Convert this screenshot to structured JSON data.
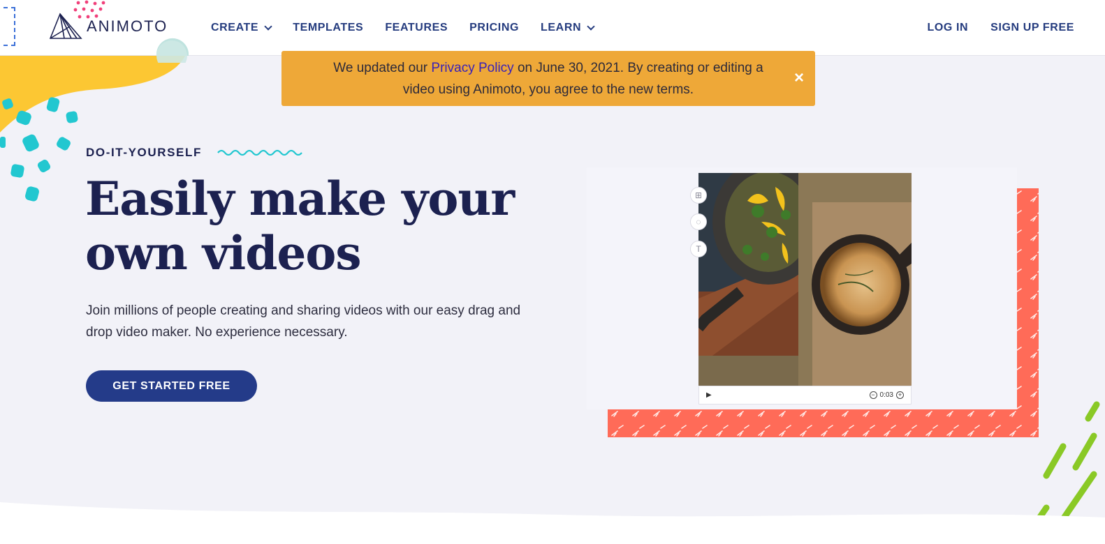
{
  "brand": {
    "name": "ANIMOTO",
    "colors": {
      "navy": "#1c2150",
      "nav_blue": "#243b7e",
      "cta_blue": "#243b89",
      "banner": "#eea838",
      "coral": "#ff6b58",
      "teal": "#22c7d0",
      "yellow": "#fcc733",
      "pink": "#f0407a",
      "green": "#8ac926"
    }
  },
  "nav": {
    "create": "CREATE",
    "templates": "TEMPLATES",
    "features": "FEATURES",
    "pricing": "PRICING",
    "learn": "LEARN",
    "login": "LOG IN",
    "signup": "SIGN UP FREE"
  },
  "banner": {
    "before_link": "We updated our ",
    "link": "Privacy Policy",
    "after_link": " on June 30, 2021. By creating or editing a video using Animoto, you agree to the new terms.",
    "close": "×"
  },
  "hero": {
    "eyebrow": "DO-IT-YOURSELF",
    "headline_line1": "Easily make your",
    "headline_line2": "own videos",
    "subtext": "Join millions of people creating and sharing videos with our easy drag and drop video maker. No experience necessary.",
    "cta": "GET STARTED FREE"
  },
  "editor": {
    "tools": [
      "layout-icon",
      "color-drop-icon",
      "text-icon"
    ],
    "play_icon": "play-icon",
    "time": "0:03",
    "zoom_out": "−",
    "zoom_in": "+"
  }
}
